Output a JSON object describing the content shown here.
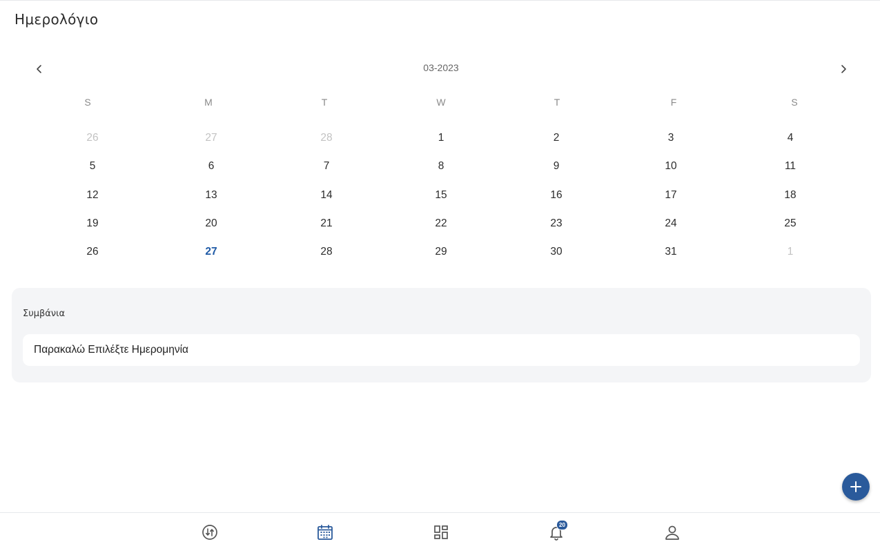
{
  "header": {
    "title": "Ημερολόγιο"
  },
  "calendar": {
    "month_label": "03-2023",
    "weekdays": [
      "S",
      "M",
      "T",
      "W",
      "T",
      "F",
      "S"
    ],
    "weeks": [
      [
        {
          "d": "26",
          "muted": true
        },
        {
          "d": "27",
          "muted": true
        },
        {
          "d": "28",
          "muted": true
        },
        {
          "d": "1"
        },
        {
          "d": "2"
        },
        {
          "d": "3"
        },
        {
          "d": "4"
        }
      ],
      [
        {
          "d": "5"
        },
        {
          "d": "6"
        },
        {
          "d": "7"
        },
        {
          "d": "8"
        },
        {
          "d": "9"
        },
        {
          "d": "10"
        },
        {
          "d": "11"
        }
      ],
      [
        {
          "d": "12"
        },
        {
          "d": "13"
        },
        {
          "d": "14"
        },
        {
          "d": "15"
        },
        {
          "d": "16"
        },
        {
          "d": "17"
        },
        {
          "d": "18"
        }
      ],
      [
        {
          "d": "19"
        },
        {
          "d": "20"
        },
        {
          "d": "21"
        },
        {
          "d": "22"
        },
        {
          "d": "23"
        },
        {
          "d": "24"
        },
        {
          "d": "25"
        }
      ],
      [
        {
          "d": "26"
        },
        {
          "d": "27",
          "today": true
        },
        {
          "d": "28"
        },
        {
          "d": "29"
        },
        {
          "d": "30"
        },
        {
          "d": "31"
        },
        {
          "d": "1",
          "muted": true
        }
      ]
    ]
  },
  "events": {
    "title": "Συμβάνια",
    "placeholder_text": "Παρακαλώ Επιλέξτε Ημερομηνία"
  },
  "fab": {
    "icon": "plus-icon"
  },
  "bottom_nav": {
    "items": [
      {
        "name": "transfer",
        "icon": "transfer-icon"
      },
      {
        "name": "calendar",
        "icon": "calendar-icon",
        "active": true
      },
      {
        "name": "dashboard",
        "icon": "dashboard-icon"
      },
      {
        "name": "notifications",
        "icon": "bell-icon",
        "badge": "20"
      },
      {
        "name": "profile",
        "icon": "user-icon"
      }
    ]
  },
  "colors": {
    "accent": "#2a5a9b",
    "today": "#1f5aa6",
    "muted_day": "#c2c2c2",
    "panel_bg": "#f4f5f7"
  }
}
